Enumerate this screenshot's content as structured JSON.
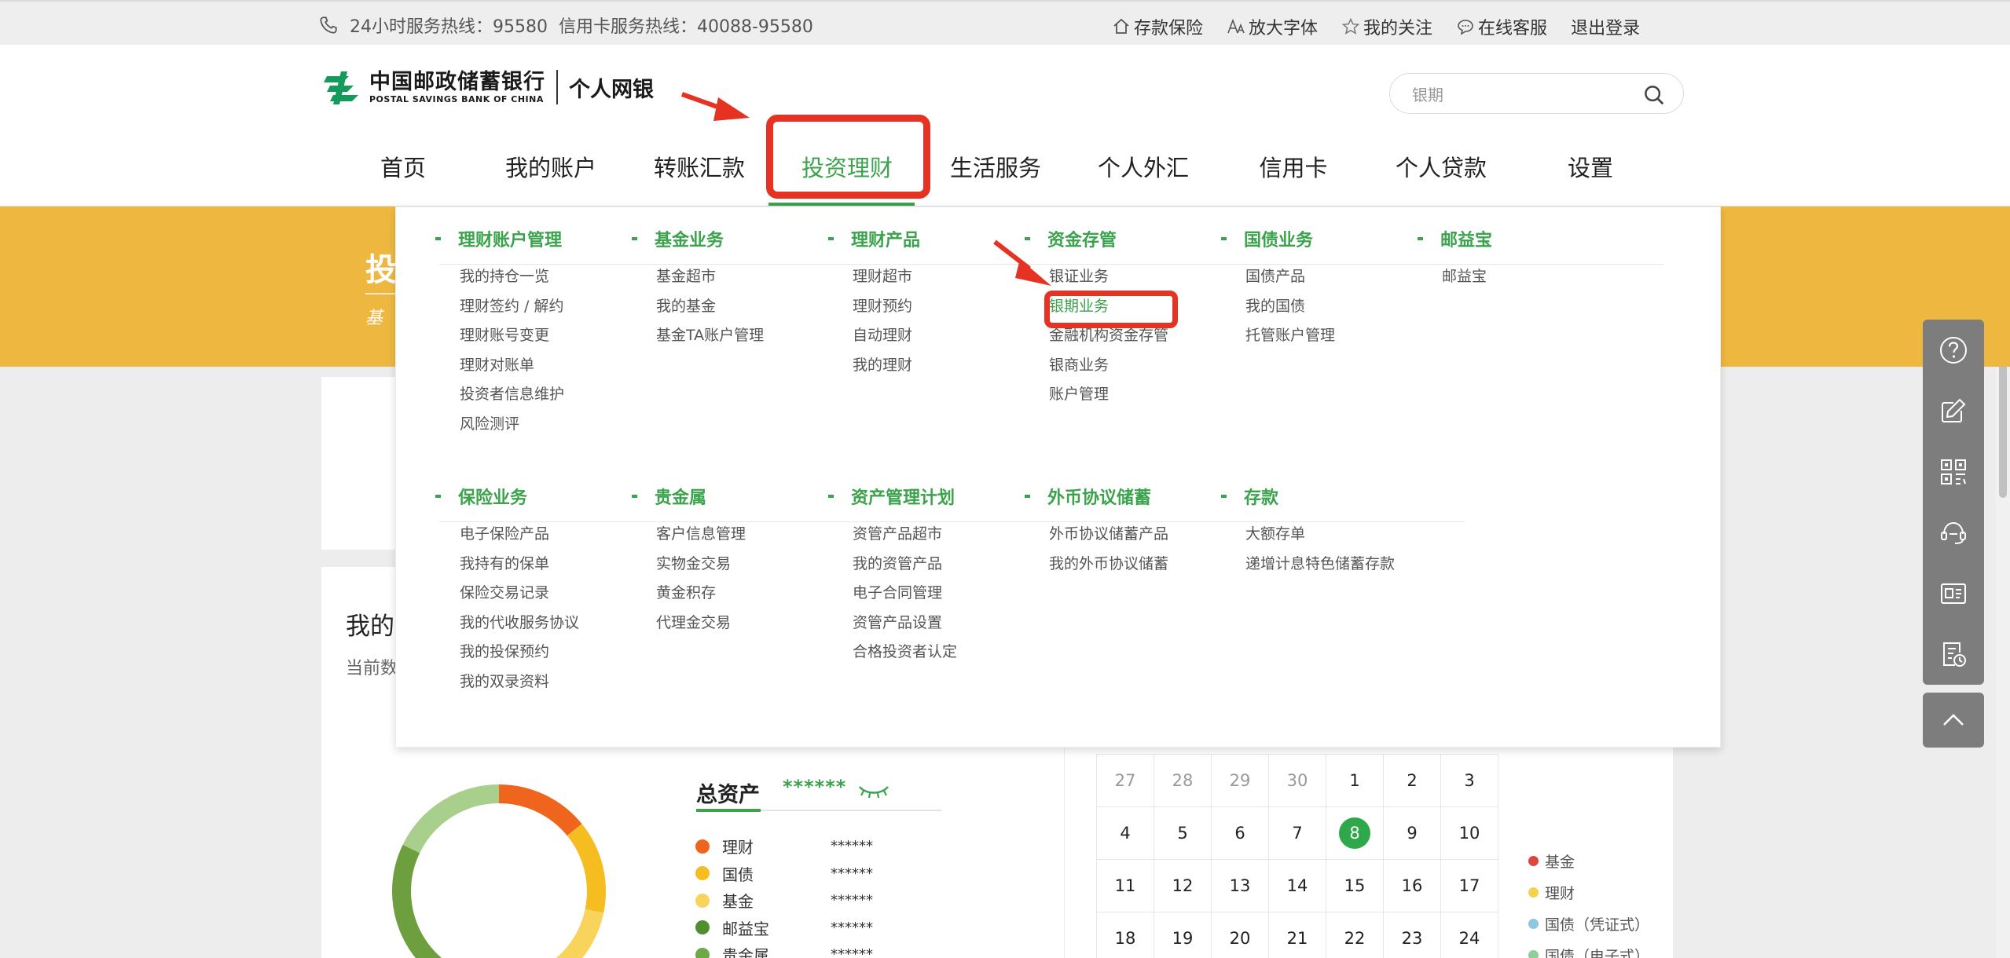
{
  "topbar": {
    "hotline_24h": "24小时服务热线：95580",
    "hotline_card": "信用卡服务热线：40088-95580",
    "links": {
      "deposit_insurance": "存款保险",
      "zoom_font": "放大字体",
      "my_follow": "我的关注",
      "online_service": "在线客服",
      "logout": "退出登录"
    }
  },
  "logo": {
    "cn": "中国邮政储蓄银行",
    "en": "POSTAL SAVINGS BANK OF CHINA",
    "product": "个人网银"
  },
  "search": {
    "value": "银期"
  },
  "nav": [
    "首页",
    "我的账户",
    "转账汇款",
    "投资理财",
    "生活服务",
    "个人外汇",
    "信用卡",
    "个人贷款",
    "设置"
  ],
  "nav_active": "投资理财",
  "banner": {
    "title": "投",
    "sub": "基"
  },
  "main": {
    "my_title": "我的",
    "my_sub": "当前数"
  },
  "dropdown": {
    "row1": [
      {
        "title": "理财账户管理",
        "items": [
          "我的持仓一览",
          "理财签约 / 解约",
          "理财账号变更",
          "理财对账单",
          "投资者信息维护",
          "风险测评"
        ]
      },
      {
        "title": "基金业务",
        "items": [
          "基金超市",
          "我的基金",
          "基金TA账户管理"
        ]
      },
      {
        "title": "理财产品",
        "items": [
          "理财超市",
          "理财预约",
          "自动理财",
          "我的理财"
        ]
      },
      {
        "title": "资金存管",
        "items": [
          "银证业务",
          "银期业务",
          "金融机构资金存管",
          "银商业务",
          "账户管理"
        ]
      },
      {
        "title": "国债业务",
        "items": [
          "国债产品",
          "我的国债",
          "托管账户管理"
        ]
      },
      {
        "title": "邮益宝",
        "items": [
          "邮益宝"
        ]
      }
    ],
    "row2": [
      {
        "title": "保险业务",
        "items": [
          "电子保险产品",
          "我持有的保单",
          "保险交易记录",
          "我的代收服务协议",
          "我的投保预约",
          "我的双录资料"
        ]
      },
      {
        "title": "贵金属",
        "items": [
          "客户信息管理",
          "实物金交易",
          "黄金积存",
          "代理金交易"
        ]
      },
      {
        "title": "资产管理计划",
        "items": [
          "资管产品超市",
          "我的资管产品",
          "电子合同管理",
          "资管产品设置",
          "合格投资者认定"
        ]
      },
      {
        "title": "外币协议储蓄",
        "items": [
          "外币协议储蓄产品",
          "我的外币协议储蓄"
        ]
      },
      {
        "title": "存款",
        "items": [
          "大额存单",
          "递增计息特色储蓄存款"
        ]
      }
    ],
    "highlighted_item": "银期业务"
  },
  "assets": {
    "title": "总资产",
    "masked": "******",
    "rows": [
      {
        "name": "理财",
        "value": "******",
        "color": "#f0651e"
      },
      {
        "name": "国债",
        "value": "******",
        "color": "#f5bd1f"
      },
      {
        "name": "基金",
        "value": "******",
        "color": "#f9d45c"
      },
      {
        "name": "邮益宝",
        "value": "******",
        "color": "#4f8f2f"
      },
      {
        "name": "贵金属",
        "value": "******",
        "color": "#6daa45"
      }
    ]
  },
  "calendar": {
    "weeks": [
      [
        "27",
        "28",
        "29",
        "30",
        "1",
        "2",
        "3"
      ],
      [
        "4",
        "5",
        "6",
        "7",
        "8",
        "9",
        "10"
      ],
      [
        "11",
        "12",
        "13",
        "14",
        "15",
        "16",
        "17"
      ],
      [
        "18",
        "19",
        "20",
        "21",
        "22",
        "23",
        "24"
      ]
    ],
    "muted": [
      "27",
      "28",
      "29",
      "30"
    ],
    "today": "8"
  },
  "legend": [
    {
      "name": "基金",
      "color": "#d9473f"
    },
    {
      "name": "理财",
      "color": "#f5d24b"
    },
    {
      "name": "国债（凭证式）",
      "color": "#8cc7e0"
    },
    {
      "name": "国债（电子式）",
      "color": "#8fcf9a"
    }
  ],
  "sidebar_icons": [
    "help-icon",
    "edit-icon",
    "qr-code-icon",
    "customer-service-icon",
    "id-card-icon",
    "history-icon"
  ],
  "colors": {
    "brand_green": "#3aa34b",
    "banner_yellow": "#eeb840",
    "highlight_red": "#e53222"
  }
}
